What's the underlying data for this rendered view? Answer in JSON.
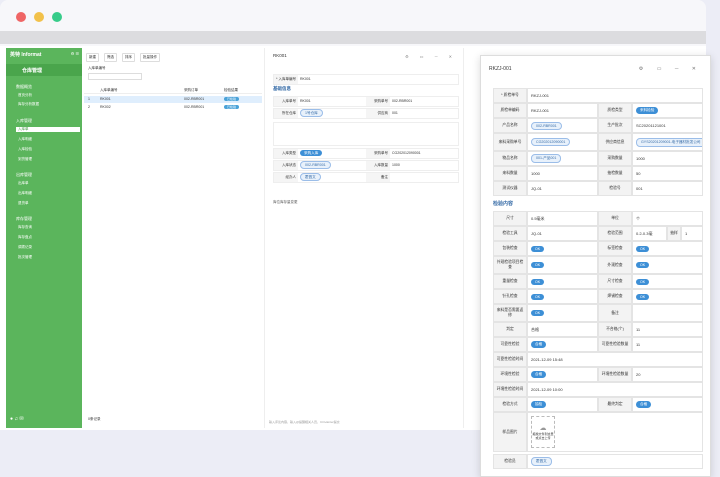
{
  "window": {
    "dot_colors": [
      "#ef6565",
      "#f2c14a",
      "#37cc8a"
    ]
  },
  "sidebar": {
    "logo": "英特 Informat",
    "title": "仓库管理",
    "groups": [
      {
        "label": "数据概览",
        "items": [
          "首页分析",
          "库存分析数据"
        ]
      },
      {
        "label": "入库管理",
        "items": [
          "入库单",
          "入库明细",
          "入库检验",
          "到货管理"
        ]
      },
      {
        "label": "出库管理",
        "items": [
          "出库单",
          "出库明细",
          "退货单"
        ]
      },
      {
        "label": "库存管理",
        "items": [
          "库存查询",
          "库存盘点",
          "调拨记录",
          "批次管理"
        ]
      }
    ]
  },
  "list": {
    "toolbar": [
      "新建",
      "筛选",
      "排序",
      "批量操作"
    ],
    "filter_label": "入库单编号",
    "columns": [
      "入库单编号",
      "采购订单",
      "检验结果"
    ],
    "rows": [
      {
        "num": "1",
        "code": "RK001",
        "po": "002-RBR001",
        "status": "已检验"
      },
      {
        "num": "2",
        "code": "RK002",
        "po": "002-RBR001",
        "status": "已检验"
      }
    ],
    "footer": "0条记录"
  },
  "midform": {
    "title": "RK001",
    "code_label": "* 入库单编号",
    "code_value": "RK001",
    "section": "基础信息",
    "rows": [
      {
        "l1": "入库单号",
        "v1": "RK001",
        "l2": "采购单号",
        "v2": "002-RBR001"
      },
      {
        "l1": "所在仓库",
        "v1": "1号仓库",
        "l2": "供应商",
        "v2": "001"
      },
      {
        "l1": "入库类型",
        "v1": "采购入库",
        "l2": "采购单号",
        "v2": "CG202012090001"
      },
      {
        "l1": "入库状态",
        "v1": "002-RBR001",
        "l2": "入库数量",
        "v2": "1000"
      },
      {
        "l1": "经办人",
        "v1": "霍昌文",
        "l2": "备注",
        "v2": ""
      }
    ],
    "sub_section": "库位库存量变更",
    "footer": "输入评论内容，输入@提醒相关人员，Ctrl+Enter提交"
  },
  "popup": {
    "title": "RKZJ-001",
    "fields": [
      {
        "label": "* 质检单号",
        "value": "RKZJ-001"
      },
      {
        "label": "质检单编码",
        "value": "RKZJ-001",
        "label2": "质检类型",
        "value2": "来料检验"
      },
      {
        "label": "产品名称",
        "value": "002-RBR001",
        "label2": "生产批次",
        "value2": "SC20201121001"
      },
      {
        "label": "来料采购单号",
        "value": "CG202012090001",
        "label2": "供应商信息",
        "value2": "GYS20201209001-电子器材批发公司"
      },
      {
        "label": "物品名称",
        "value": "001-产品001",
        "label2": "采购数量",
        "value2": "1000"
      },
      {
        "label": "来料数量",
        "value": "1000",
        "label2": "抽检数量",
        "value2": "50"
      },
      {
        "label": "测试仪器",
        "value": "JQ-01",
        "label2": "检验号",
        "value2": "001"
      }
    ],
    "section": "检验内容",
    "checks": [
      {
        "label": "尺寸",
        "value": "0.5毫米",
        "label2": "单位",
        "value2": "个"
      },
      {
        "label": "检验工具",
        "value": "JQ-01",
        "label2": "检验范围",
        "value2": "0.2-0.3毫",
        "label3": "抽样",
        "value3": "1"
      },
      {
        "label": "包装检查",
        "value": "OK",
        "label2": "标签检查",
        "value2": "OK"
      },
      {
        "label": "外观检验项目检查",
        "value": "OK",
        "label2": "外观检查",
        "value2": "OK"
      },
      {
        "label": "重量检查",
        "value": "OK",
        "label2": "尺寸检查",
        "value2": "OK"
      },
      {
        "label": "针孔检查",
        "value": "OK",
        "label2": "焊锡检查",
        "value2": "OK"
      },
      {
        "label": "来料是否需要返修",
        "value": "OK",
        "label2": "备注",
        "value2": ""
      },
      {
        "label": "判定",
        "value": "合格",
        "label2": "不合格(个)",
        "value2": "11"
      },
      {
        "label": "可靠性检验",
        "value": "合格",
        "label2": "可靠性检验数量",
        "value2": "11"
      },
      {
        "label": "可靠性检验时间",
        "value": "2021-12-09 15:48"
      },
      {
        "label": "环境性检验",
        "value": "合格",
        "label2": "环境性检验数量",
        "value2": "20"
      },
      {
        "label": "环境性检验时间",
        "value": "2021-12-09 10:00"
      },
      {
        "label": "检验方式",
        "value": "抽检",
        "label2": "最终判定",
        "value2": "合格"
      }
    ],
    "upload_label": "样品图片",
    "upload_hint": "拖拽文件到这里或点击上传",
    "inspector_label": "检验员",
    "inspector": "霍昌文"
  }
}
